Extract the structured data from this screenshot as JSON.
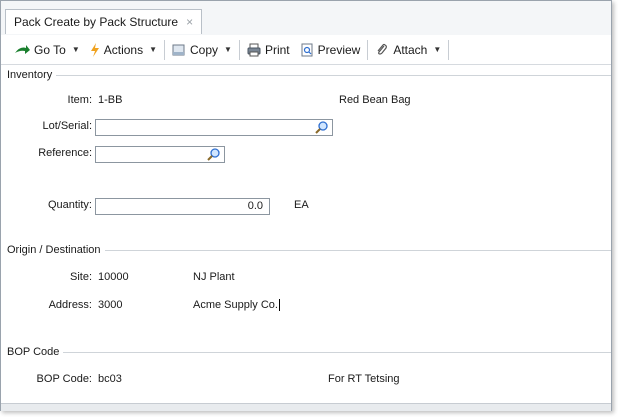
{
  "tab": {
    "title": "Pack Create by Pack Structure",
    "close": "×"
  },
  "toolbar": {
    "goto": "Go To",
    "actions": "Actions",
    "copy": "Copy",
    "print": "Print",
    "preview": "Preview",
    "attach": "Attach"
  },
  "inventory": {
    "legend": "Inventory",
    "item_label": "Item:",
    "item_value": "1-BB",
    "item_desc": "Red Bean Bag",
    "lot_label": "Lot/Serial:",
    "lot_value": "",
    "reference_label": "Reference:",
    "reference_value": "",
    "quantity_label": "Quantity:",
    "quantity_value": "0.0",
    "uom": "EA"
  },
  "origin": {
    "legend": "Origin / Destination",
    "site_label": "Site:",
    "site_value": "10000",
    "site_desc": "NJ Plant",
    "address_label": "Address:",
    "address_value": "3000",
    "address_desc": "Acme Supply Co."
  },
  "bop": {
    "legend": "BOP Code",
    "code_label": "BOP Code:",
    "code_value": "bc03",
    "code_desc": "For RT Tetsing"
  },
  "colors": {
    "accent": "#1a7f2e",
    "border": "#8c96a0",
    "icon_blue": "#2f6fd0"
  }
}
